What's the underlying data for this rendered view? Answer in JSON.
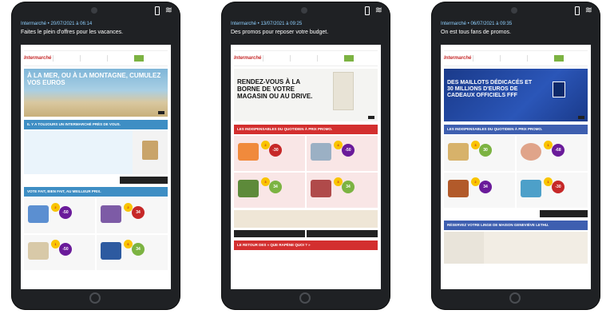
{
  "phones": [
    {
      "notification": {
        "meta": "Intermarché • 20/07/2021 à 06:14",
        "message": "Faites le plein d'offres pour les vacances."
      },
      "hero_title": "À LA MER, OU À LA MONTAGNE, CUMULEZ VOS EUROS",
      "band1": "IL Y A TOUJOURS UN INTERMARCHÉ PRÈS DE VOUS.",
      "band2": "VOTE FAIT, BIEN FAIT, AU MEILLEUR PRIX."
    },
    {
      "notification": {
        "meta": "Intermarché • 13/07/2021 à 09:25",
        "message": "Des promos pour reposer votre budget."
      },
      "hero_title": "RENDEZ-VOUS À LA BORNE DE VOTRE MAGASIN OU AU DRIVE.",
      "band1": "LES INDISPENSABLES DU QUOTIDIEN À PRIX PROMO.",
      "band2": "LE RETOUR DES « QUE RAPÈNE QUOI ? »"
    },
    {
      "notification": {
        "meta": "Intermarché • 06/07/2021 à 09:35",
        "message": "On est tous fans de promos."
      },
      "hero_title": "DES MAILLOTS DÉDICACÉS ET 30 MILLIONS D'EUROS DE CADEAUX OFFICIELS FFF",
      "band1": "LES INDISPENSABLES DU QUOTIDIEN À PRIX PROMO.",
      "band2": "RÉSERVEZ VOTRE LINGE DE MAISON GENEVIÈVE LETHU."
    }
  ],
  "logo_text": "Intermarché",
  "colors": {
    "brand_red": "#c62828",
    "band_blue": "#3e8ec4",
    "promo_purple": "#6a1b9a",
    "promo_green": "#7cb342"
  }
}
